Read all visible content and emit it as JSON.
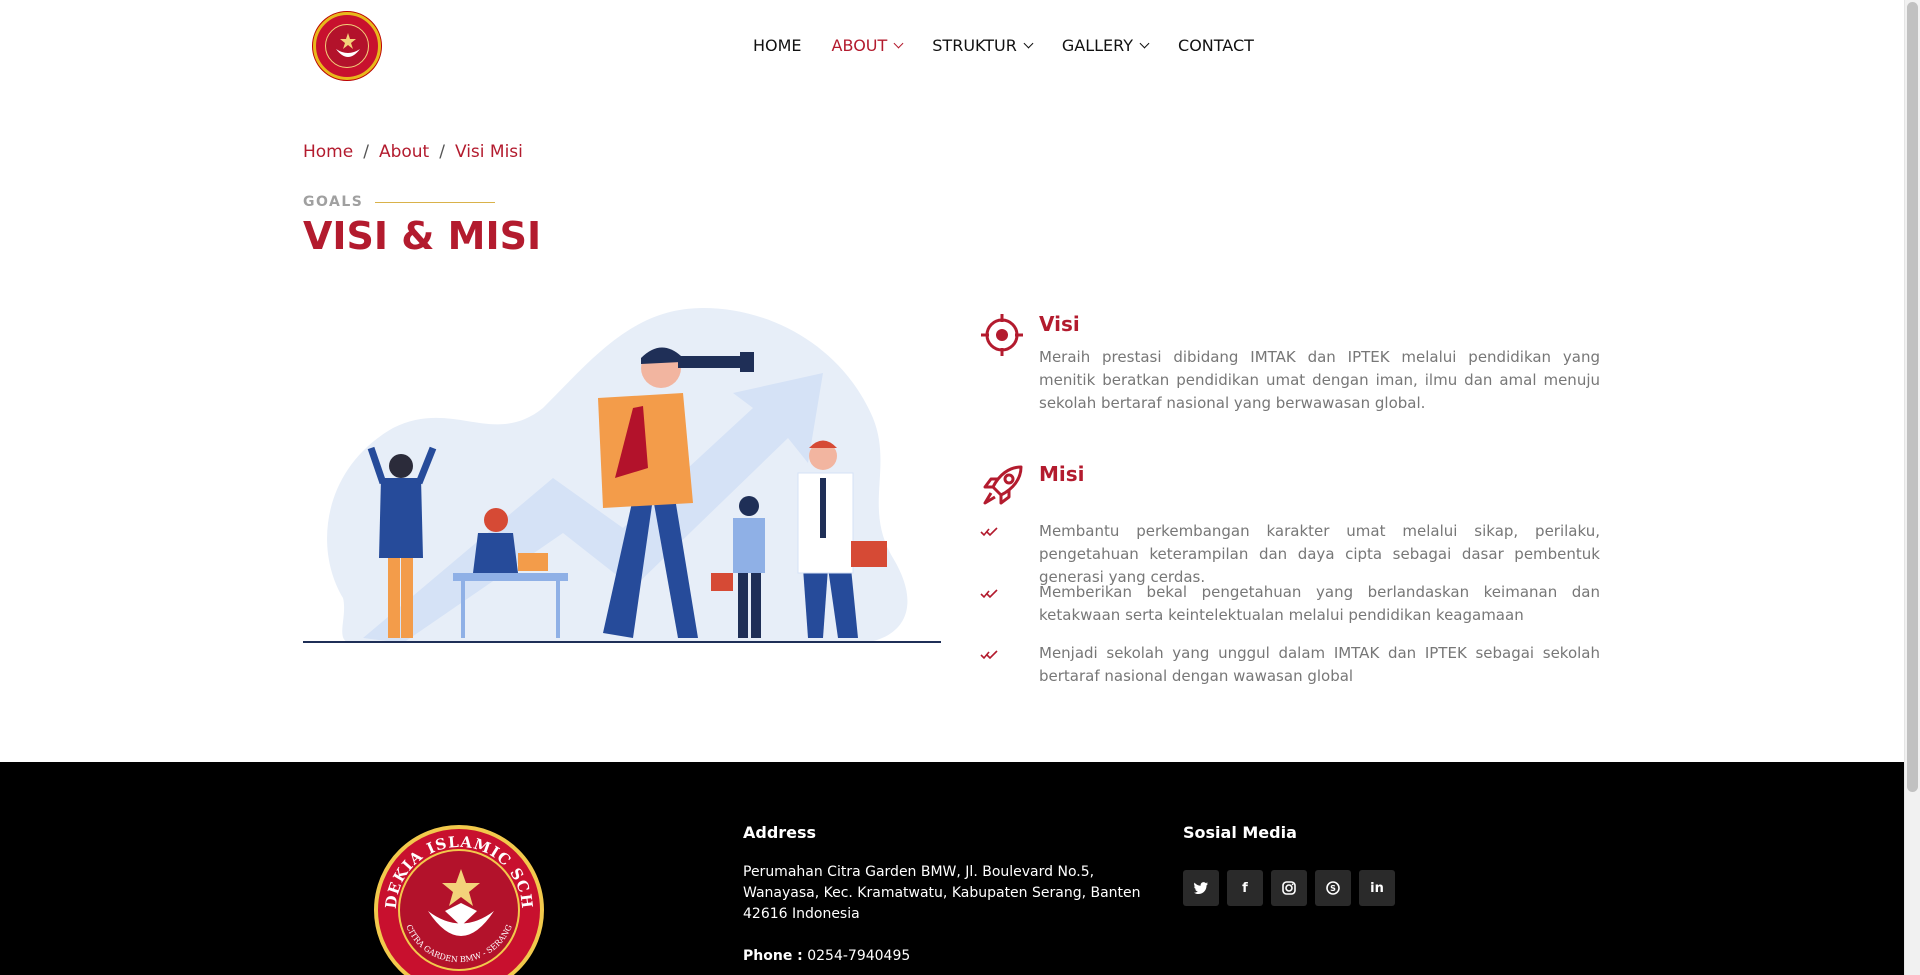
{
  "nav": {
    "items": [
      {
        "label": "HOME",
        "active": false,
        "dropdown": false
      },
      {
        "label": "ABOUT",
        "active": true,
        "dropdown": true
      },
      {
        "label": "STRUKTUR",
        "active": false,
        "dropdown": true
      },
      {
        "label": "GALLERY",
        "active": false,
        "dropdown": true
      },
      {
        "label": "CONTACT",
        "active": false,
        "dropdown": false
      }
    ]
  },
  "breadcrumb": {
    "home": "Home",
    "about": "About",
    "current": "Visi Misi",
    "sep": "/"
  },
  "section": {
    "eyebrow": "GOALS",
    "title": "VISI & MISI"
  },
  "visi": {
    "title": "Visi",
    "icon": "target-icon",
    "text": "Meraih prestasi dibidang IMTAK dan IPTEK melalui pendidikan yang menitik beratkan pendidikan umat dengan iman, ilmu dan amal menuju sekolah bertaraf nasional yang berwawasan global."
  },
  "misi": {
    "title": "Misi",
    "icon": "rocket-icon",
    "items": [
      "Membantu perkembangan karakter umat melalui sikap, perilaku, pengetahuan keterampilan dan daya cipta sebagai dasar pembentuk generasi yang cerdas.",
      "Memberikan bekal pengetahuan yang berlandaskan keimanan dan ketakwaan serta keintelektualan melalui pendidikan keagamaan",
      "Menjadi sekolah yang unggul dalam IMTAK dan IPTEK sebagai sekolah bertaraf nasional dengan wawasan global"
    ]
  },
  "footer": {
    "logo_text": "CENDEKIA ISLAMIC SCHOOL",
    "logo_subtext": "CITRA GARDEN BMW - SERANG",
    "address_heading": "Address",
    "address_text": "Perumahan Citra Garden BMW, Jl. Boulevard No.5, Wanayasa, Kec. Kramatwatu, Kabupaten Serang, Banten 42616 Indonesia",
    "phone_label": "Phone :",
    "phone_value": "0254-7940495",
    "social_heading": "Sosial Media",
    "social": [
      {
        "icon": "twitter-icon",
        "glyph": "🐦"
      },
      {
        "icon": "facebook-icon",
        "glyph": "f"
      },
      {
        "icon": "instagram-icon",
        "glyph": "◎"
      },
      {
        "icon": "skype-icon",
        "glyph": "S"
      },
      {
        "icon": "linkedin-icon",
        "glyph": "in"
      }
    ]
  },
  "colors": {
    "accent": "#b31b2e",
    "gold": "#d9b24a",
    "footer_bg": "#000000"
  }
}
